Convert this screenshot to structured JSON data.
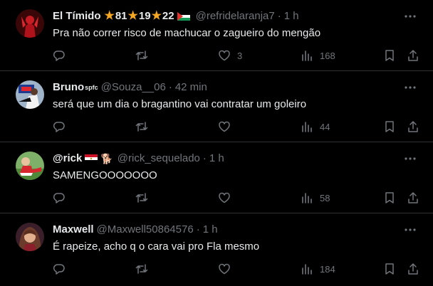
{
  "tweets": [
    {
      "name": "El Tímido",
      "badges": [
        {
          "icon": "star",
          "value": "81"
        },
        {
          "icon": "star",
          "value": "19"
        },
        {
          "icon": "star",
          "value": "22"
        }
      ],
      "flag": "palestine-flag",
      "handle": "@refridelaranja7",
      "sep": "·",
      "time": "1 h",
      "text": "Pra não correr risco de machucar o zagueiro do mengão",
      "replies": "",
      "retweets": "",
      "likes": "3",
      "views": "168"
    },
    {
      "name": "Bruno",
      "name_suffix": "spfc",
      "handle": "@Souza__06",
      "sep": "·",
      "time": "42 min",
      "text": "será que um dia o bragantino vai contratar um goleiro",
      "replies": "",
      "retweets": "",
      "likes": "",
      "views": "44"
    },
    {
      "name": "@rick",
      "flag": "egypt-flag",
      "emoji": "🐕",
      "handle": "@rick_sequelado",
      "sep": "·",
      "time": "1 h",
      "text": "SAMENGOOOOOOO",
      "replies": "",
      "retweets": "",
      "likes": "",
      "views": "58"
    },
    {
      "name": "Maxwell",
      "handle": "@Maxwell50864576",
      "sep": "·",
      "time": "1 h",
      "text": "É rapeize, acho q o cara vai pro Fla mesmo",
      "replies": "",
      "retweets": "",
      "likes": "",
      "views": "184"
    }
  ],
  "colors": {
    "background": "#000000",
    "text": "#e7e9ea",
    "muted": "#71767b",
    "border": "#2f3336",
    "star": "#f5a623"
  }
}
